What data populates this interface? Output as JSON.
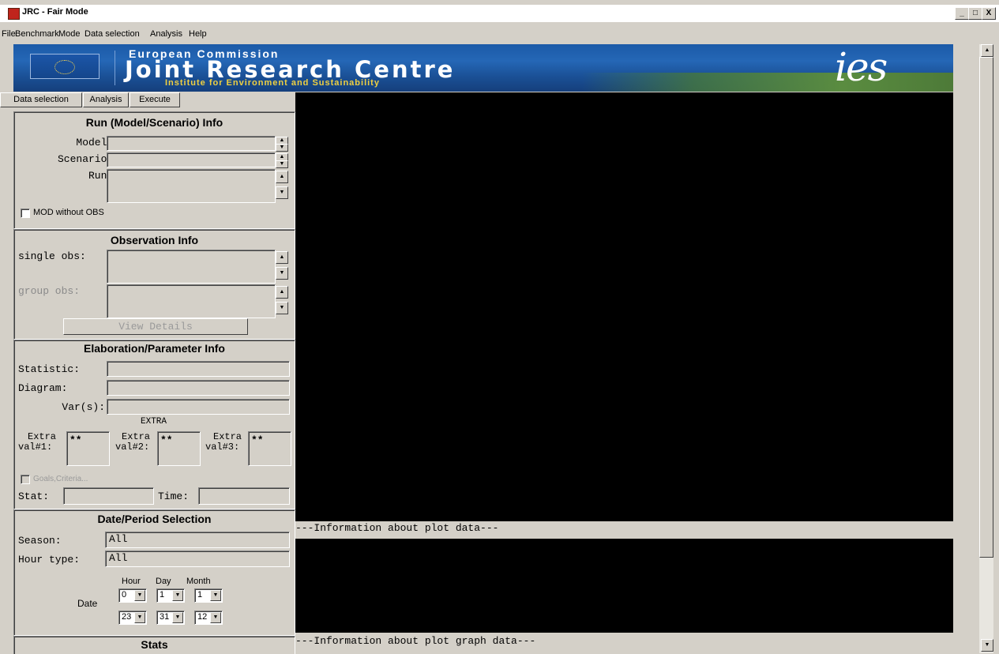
{
  "window": {
    "title": "JRC - Fair Mode",
    "controls": [
      "_",
      "□",
      "X"
    ]
  },
  "menubar": [
    "File",
    "Benchmark",
    "Mode",
    "Data selection",
    "Analysis",
    "Help"
  ],
  "banner": {
    "line1": "European Commission",
    "line2": "Joint Research Centre",
    "line3": "Institute for Environment and Sustainability",
    "logo": "ies"
  },
  "tabs": [
    "Data selection",
    "Analysis",
    "Execute"
  ],
  "run_info": {
    "title": "Run (Model/Scenario) Info",
    "models_label": "Models:",
    "scenarios_label": "Scenarios:",
    "runs_label": "Runs:",
    "mod_without_obs": "MOD without OBS"
  },
  "obs_info": {
    "title": "Observation Info",
    "single_obs_label": "single obs:",
    "group_obs_label": "group obs:",
    "view_details": "View Details"
  },
  "elab_info": {
    "title": "Elaboration/Parameter Info",
    "statistic_label": "Statistic:",
    "diagram_label": "Diagram:",
    "vars_label": "Var(s):",
    "extra_header": "EXTRA",
    "extra1_label_a": "Extra",
    "extra1_label_b": "val#1:",
    "extra2_label_a": "Extra",
    "extra2_label_b": "val#2:",
    "extra3_label_a": "Extra",
    "extra3_label_b": "val#3:",
    "extra1_value": "**",
    "extra2_value": "**",
    "extra3_value": "**",
    "goals_label": "Goals,Criteria...",
    "stat_label": "Stat:",
    "time_label": "Time:"
  },
  "date_selection": {
    "title": "Date/Period Selection",
    "season_label": "Season:",
    "season_value": "All",
    "hour_type_label": "Hour type:",
    "hour_type_value": "All",
    "col_hour": "Hour",
    "col_day": "Day",
    "col_month": "Month",
    "date_label": "Date",
    "start_hour": "0",
    "start_day": "1",
    "start_month": "1",
    "end_hour": "23",
    "end_day": "31",
    "end_month": "12"
  },
  "stats": {
    "title": "Stats"
  },
  "plot": {
    "info_plot_data": "---Information about plot data---",
    "info_plot_graph": "---Information about plot graph data---"
  },
  "icons": {
    "app": "jrc-app-icon",
    "scroll_up": "▲",
    "scroll_down": "▼",
    "dropdown": "▼"
  }
}
